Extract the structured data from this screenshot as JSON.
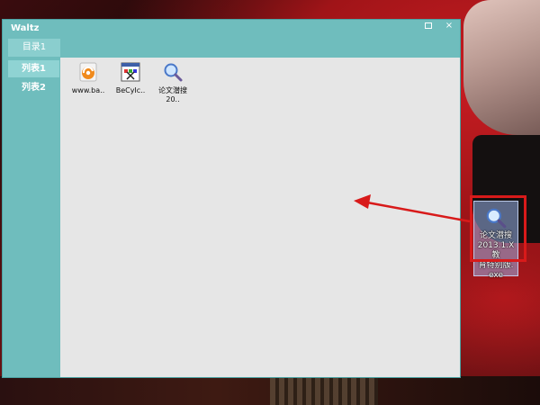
{
  "window": {
    "title": "Waltz",
    "restore_icon": "restore-icon",
    "close_label": "×"
  },
  "tabs": {
    "catalog": "目录1"
  },
  "sidebar": {
    "items": [
      {
        "label": "列表1",
        "active": true
      },
      {
        "label": "列表2",
        "active": false
      }
    ]
  },
  "files": [
    {
      "name": "www.ba..",
      "icon": "browser-orange-icon"
    },
    {
      "name": "BeCyIc..",
      "icon": "icon-editor-app-icon"
    },
    {
      "name": "论文潜搜",
      "name2": "20..",
      "icon": "magnifier-search-icon"
    }
  ],
  "desktop": {
    "icon_label": "论文潜搜\n2013.1.X 教育特别版.exe",
    "icon_label_line1": "论文潜搜",
    "icon_label_line2": "2013.1.X 教",
    "icon_label_line3": "育特别版.exe",
    "highlight_color": "#d81a1a"
  }
}
